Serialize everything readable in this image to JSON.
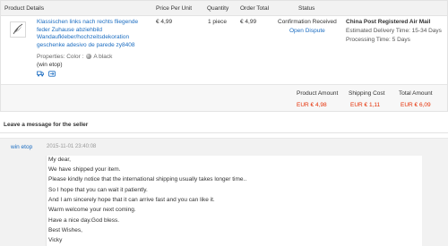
{
  "table": {
    "headers": {
      "product_details": "Product Details",
      "price_per_unit": "Price Per Unit",
      "quantity": "Quantity",
      "order_total": "Order Total",
      "status": "Status"
    }
  },
  "product": {
    "title_lines": [
      "Klassischen links nach rechts fliegende",
      "feder Zuhause abziehbild",
      "Wandaufkleber/hochzeitsdekoration",
      "geschenke adesivo de parede zy8408"
    ],
    "properties_label": "Properties: Color :",
    "color_value": "A black",
    "seller": "(win etop)",
    "icons": [
      "truck-icon",
      "return-icon"
    ],
    "price": "€ 4,99",
    "quantity": "1 piece",
    "order_total": "€ 4,99",
    "status": "Confirmation Received",
    "open_dispute": "Open Dispute",
    "shipping_method": "China Post Registered Air Mail",
    "delivery_time": "Estimated Delivery Time: 15-34 Days",
    "processing_time": "Processing Time: 5 Days"
  },
  "summary": {
    "product_amount_label": "Product Amount",
    "product_amount": "EUR € 4,98",
    "shipping_cost_label": "Shipping Cost",
    "shipping_cost": "EUR € 1,11",
    "total_amount_label": "Total Amount",
    "total_amount": "EUR € 6,09"
  },
  "message_section": {
    "heading": "Leave a message for the seller",
    "author": "win etop",
    "timestamp": "2015-11-01 23:40:08",
    "lines": [
      "My dear,",
      "We have shipped your item.",
      "Please kindly notice that the international shipping usually takes longer time..",
      "So I hope that you can wait it patiently.",
      "And I am sincerely hope that it can arrive fast and you can like it.",
      "Warm welcome your next coming.",
      "Have a nice day.God bless.",
      "Best Wishes,",
      "Vicky"
    ]
  },
  "colors": {
    "link": "#1a6cc1",
    "price_red": "#e62e04",
    "header_bg": "#f2f2f2"
  }
}
